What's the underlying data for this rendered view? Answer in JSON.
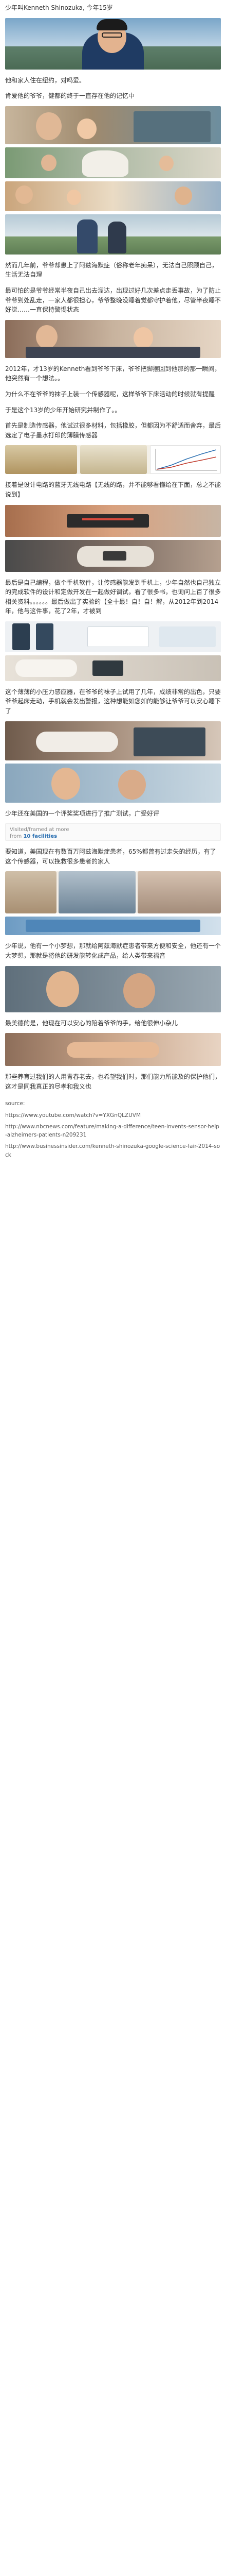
{
  "paragraphs": [
    "少年叫Kenneth Shinozuka, 今年15岁",
    "他和家人住在纽约，对吗爱。",
    "肯爱他的爷爷，健都的终于一直存在他的记忆中",
    "然而几年前，爷爷却患上了阿兹海默症（俗称老年痴呆），无法自己照顾自己，生活无法自理",
    "最可怕的是爷爷经常半夜自己出去溜达，出现过好几次差点走丢事故，为了防止爷爷到处乱走，一家人都很担心，爷爷整晚没睡着觉都守护着他，尽管半夜睡不好觉……一直保持警惕状态",
    "2012年，才13岁的Kenneth看到爷爷下床，爷爷把脚摆回到他那的那一瞬间，他突然有一个想法。。",
    "为什么不在爷爷的袜子上装一个传感器呢，这样爷爷下床活动的时候就有提醒",
    "于是这个13岁的少年开始研究并制作了。。",
    "首先是制造传感器，他试过很多材料，包括橡胶，但都因为不舒适而舍弃，最后选定了电子墨水打印的薄膜传感器",
    "接着是设计电路的蓝牙无线电路【无线的路，并不能够看懂给在下面，总之不能说到】",
    "最后是自己编程，做个手机软件，让传感器能发到手机上，少年自然也自己独立的完成软件的设计和定做开发在一起做好调试，看了很多书，也询问上百了很多相关资料。。。。。。最后做出了实验的【全十最！自！自！解，从2012年到2014年，他与这件事，花了2年，才被到",
    "这个薄薄的小压力感应器，在爷爷的袜子上试用了几年，成绩非常的出色，只要爷爷起床走动，手机就会发出警报，这种想能如您如的能够让爷爷可以安心睡下了",
    "少年还在美国的一个评奖奖项进行了推广测试，广受好评",
    "要知道，美国现在有数百万阿兹海默症患者，65%都曾有过走失的经历，有了这个传感器，可以挽救很多患者的家人",
    "少年说，他有一个小梦想，那就给阿兹海默症患者带来方便和安全，他还有一个大梦想，那就是将他的研发能转化成产品，给人类带来福音",
    "最美德的是，他现在可以安心的陪着爷爷的手，给他很伸小杂儿",
    "那些养育过我们的人用青春老去，也希望我们时，那们能力所能及的保护他们，这才是同我真正的尽孝和我义也"
  ],
  "captions": {
    "visited": "Visited/framed at more",
    "from_label": "from",
    "from_count": "10 facilities"
  },
  "sources": {
    "label": "source:",
    "links": [
      "https://www.youtube.com/watch?v=YXGnQLZUVM",
      "http://www.nbcnews.com/feature/making-a-difference/teen-invents-sensor-help-alzheimers-patients-n209231",
      "http://www.businessinsider.com/kenneth-shinozuka-google-science-fair-2014-sock"
    ]
  },
  "colors": {
    "accent": "#2a6fb1"
  }
}
